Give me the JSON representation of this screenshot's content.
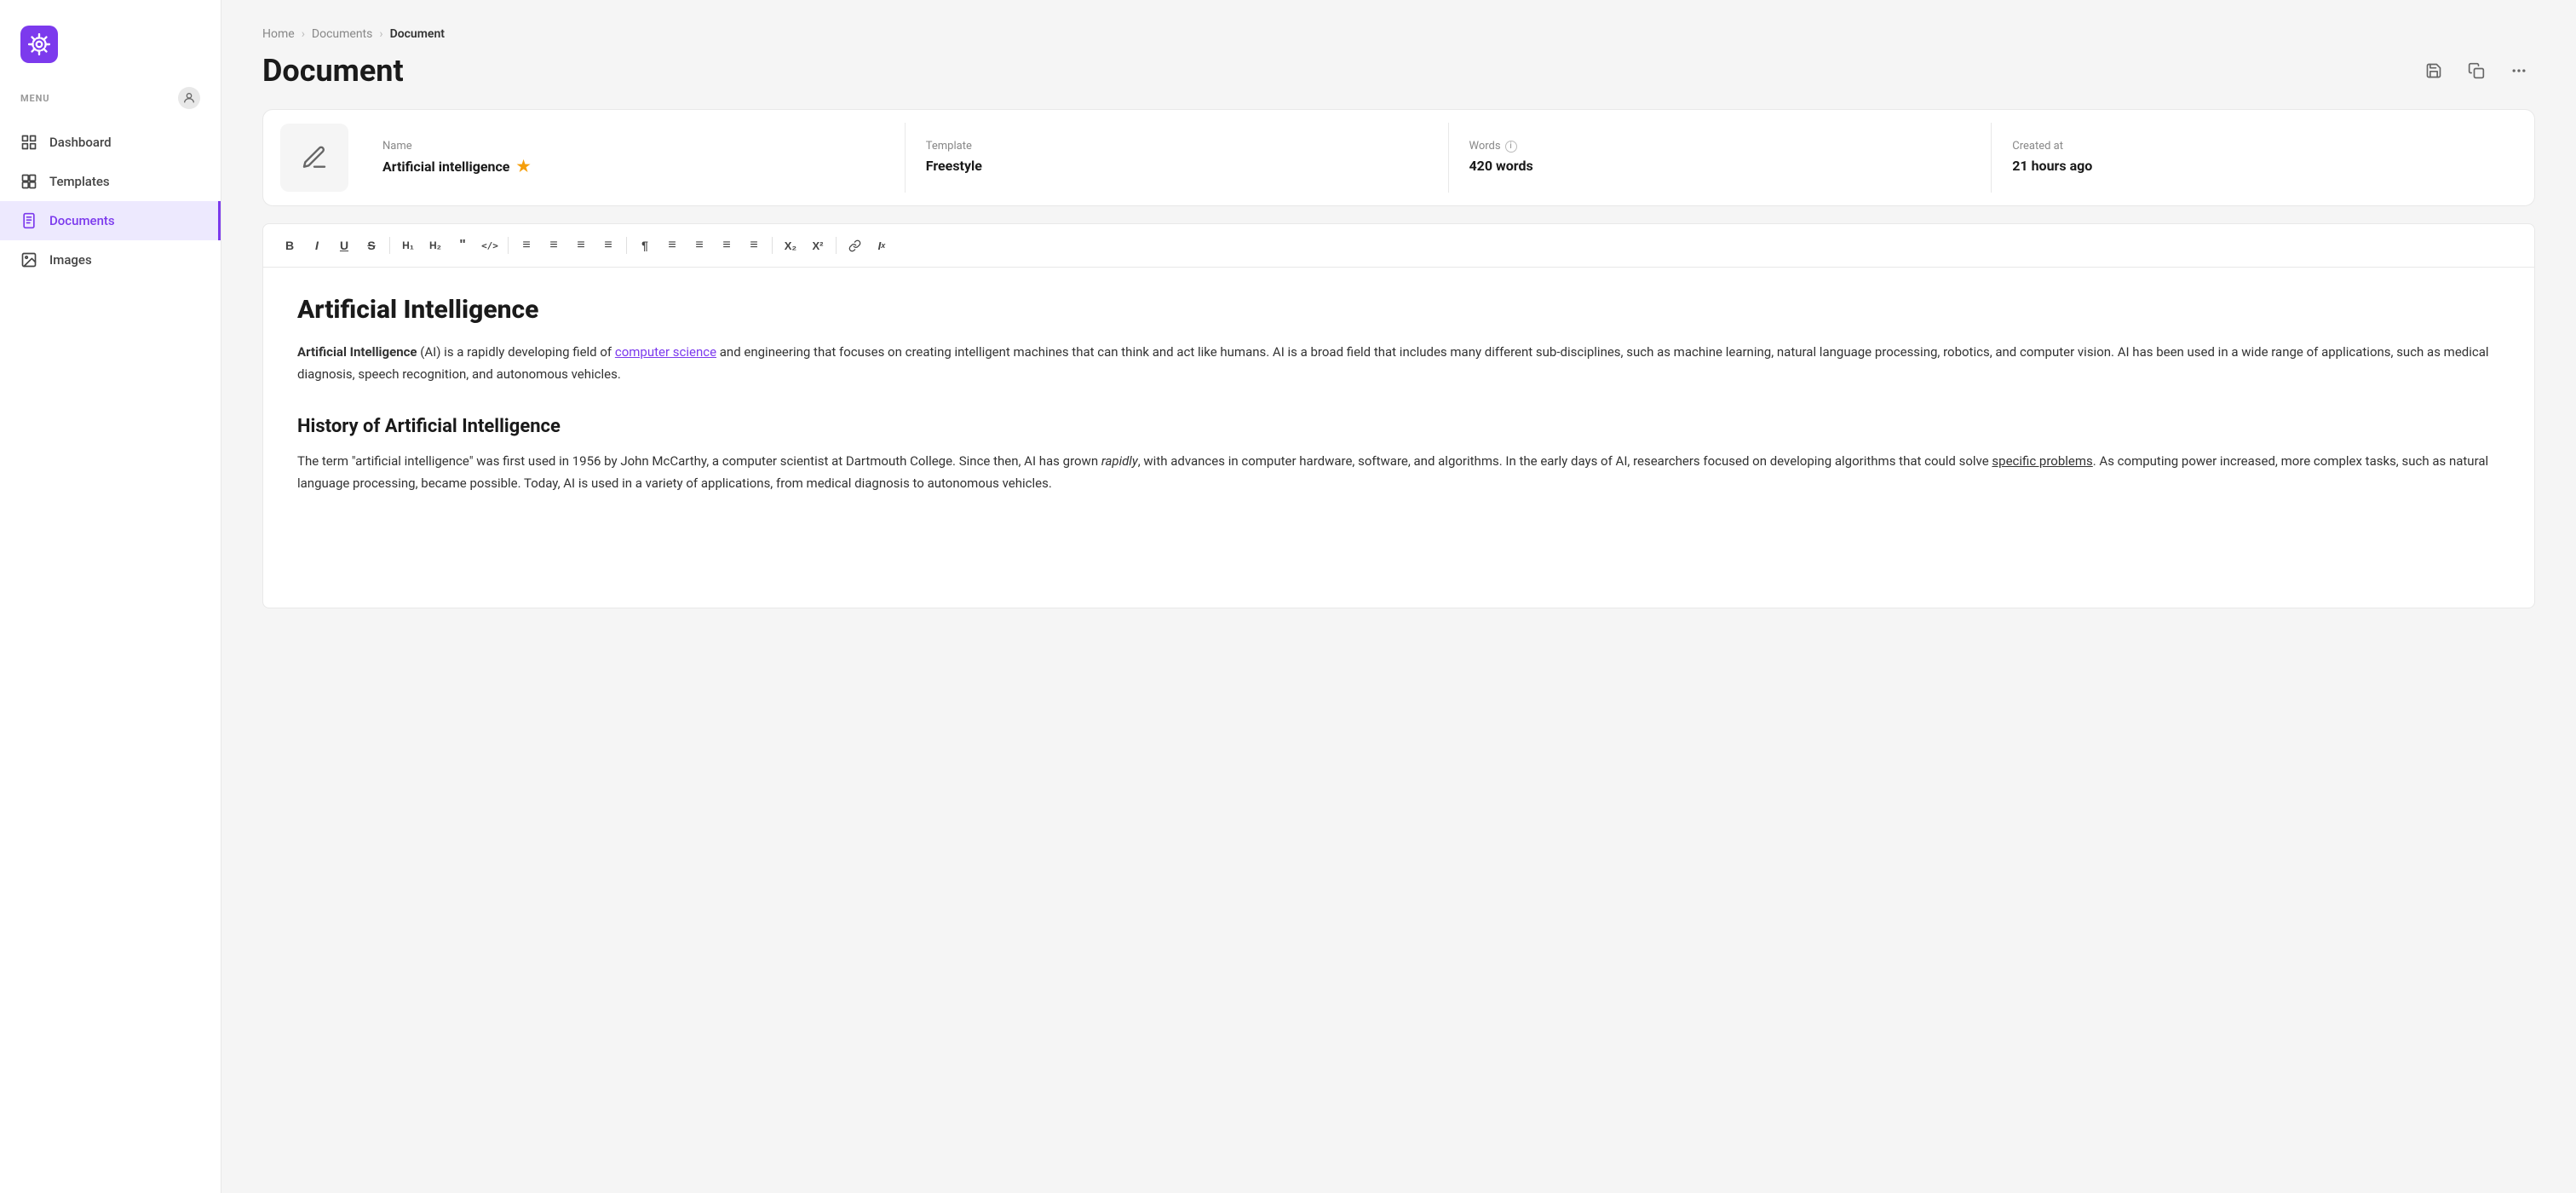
{
  "sidebar": {
    "logo_alt": "App logo",
    "menu_label": "MENU",
    "items": [
      {
        "id": "dashboard",
        "label": "Dashboard",
        "active": false
      },
      {
        "id": "templates",
        "label": "Templates",
        "active": false
      },
      {
        "id": "documents",
        "label": "Documents",
        "active": true
      },
      {
        "id": "images",
        "label": "Images",
        "active": false
      }
    ]
  },
  "breadcrumb": {
    "home": "Home",
    "documents": "Documents",
    "current": "Document"
  },
  "page": {
    "title": "Document"
  },
  "info_card": {
    "name_label": "Name",
    "name_value": "Artificial intelligence",
    "template_label": "Template",
    "template_value": "Freestyle",
    "words_label": "Words",
    "words_value": "420 words",
    "created_label": "Created at",
    "created_value": "21 hours ago"
  },
  "toolbar": {
    "buttons": [
      "B",
      "I",
      "U",
      "S",
      "H1",
      "H2",
      "❝",
      "</>",
      "≡",
      "≡",
      "≡",
      "≡",
      "¶",
      "≡",
      "≡",
      "≡",
      "≡",
      "₂",
      "²",
      "🔗",
      "Ix"
    ]
  },
  "editor": {
    "heading": "Artificial Intelligence",
    "para1_bold": "Artificial Intelligence",
    "para1_rest": " (AI) is a rapidly developing field of ",
    "para1_link": "computer science",
    "para1_end": " and engineering that focuses on creating intelligent machines that can think and act like humans. AI is a broad field that includes many different sub-disciplines, such as machine learning, natural language processing, robotics, and computer vision. AI has been used in a wide range of applications, such as medical diagnosis, speech recognition, and autonomous vehicles.",
    "heading2": "History of Artificial Intelligence",
    "para2_start": "The term \"artificial intelligence\" was first used in 1956 by John McCarthy, a computer scientist at Dartmouth College. Since then, AI has grown ",
    "para2_italic": "rapidly",
    "para2_mid": ", with advances in computer hardware, software, and algorithms. In the early days of AI, researchers focused on developing algorithms that could solve ",
    "para2_underline": "specific problems",
    "para2_end": ". As computing power increased, more complex tasks, such as natural language processing, became possible. Today, AI is used in a variety of applications, from medical diagnosis to autonomous vehicles."
  }
}
